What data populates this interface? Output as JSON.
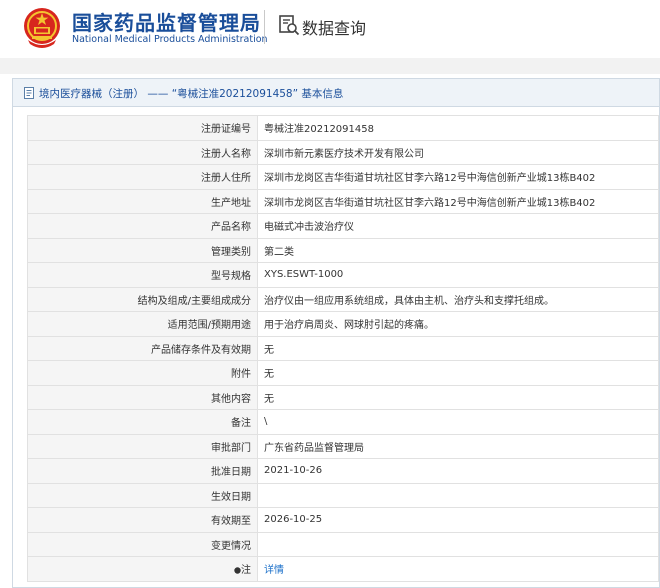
{
  "header": {
    "org_name_cn": "国家药品监督管理局",
    "org_name_en": "National Medical Products Administration",
    "query_label": "数据查询"
  },
  "panel": {
    "category": "境内医疗器械（注册）",
    "separator": "——",
    "cert_quoted": "“粤械注准20212091458”",
    "suffix": "基本信息"
  },
  "rows": [
    {
      "label": "注册证编号",
      "value": "粤械注准20212091458"
    },
    {
      "label": "注册人名称",
      "value": "深圳市新元素医疗技术开发有限公司"
    },
    {
      "label": "注册人住所",
      "value": "深圳市龙岗区吉华街道甘坑社区甘李六路12号中海信创新产业城13栋B402"
    },
    {
      "label": "生产地址",
      "value": "深圳市龙岗区吉华街道甘坑社区甘李六路12号中海信创新产业城13栋B402"
    },
    {
      "label": "产品名称",
      "value": "电磁式冲击波治疗仪"
    },
    {
      "label": "管理类别",
      "value": "第二类"
    },
    {
      "label": "型号规格",
      "value": "XYS.ESWT-1000"
    },
    {
      "label": "结构及组成/主要组成成分",
      "value": "治疗仪由一组应用系统组成，具体由主机、治疗头和支撑托组成。"
    },
    {
      "label": "适用范围/预期用途",
      "value": "用于治疗肩周炎、网球肘引起的疼痛。"
    },
    {
      "label": "产品储存条件及有效期",
      "value": "无"
    },
    {
      "label": "附件",
      "value": "无"
    },
    {
      "label": "其他内容",
      "value": "无"
    },
    {
      "label": "备注",
      "value": "\\"
    },
    {
      "label": "审批部门",
      "value": "广东省药品监督管理局"
    },
    {
      "label": "批准日期",
      "value": "2021-10-26"
    },
    {
      "label": "生效日期",
      "value": ""
    },
    {
      "label": "有效期至",
      "value": "2026-10-25"
    },
    {
      "label": "变更情况",
      "value": ""
    }
  ],
  "note_row": {
    "label": "注",
    "link_text": "详情"
  },
  "colors": {
    "brand_blue": "#1a4e9a",
    "link_blue": "#1a6fc9",
    "emblem_red": "#d7261e",
    "emblem_gold": "#f4c430"
  },
  "icons": [
    "national-emblem-icon",
    "magnifier-document-icon",
    "document-icon",
    "info-bullet-icon"
  ]
}
